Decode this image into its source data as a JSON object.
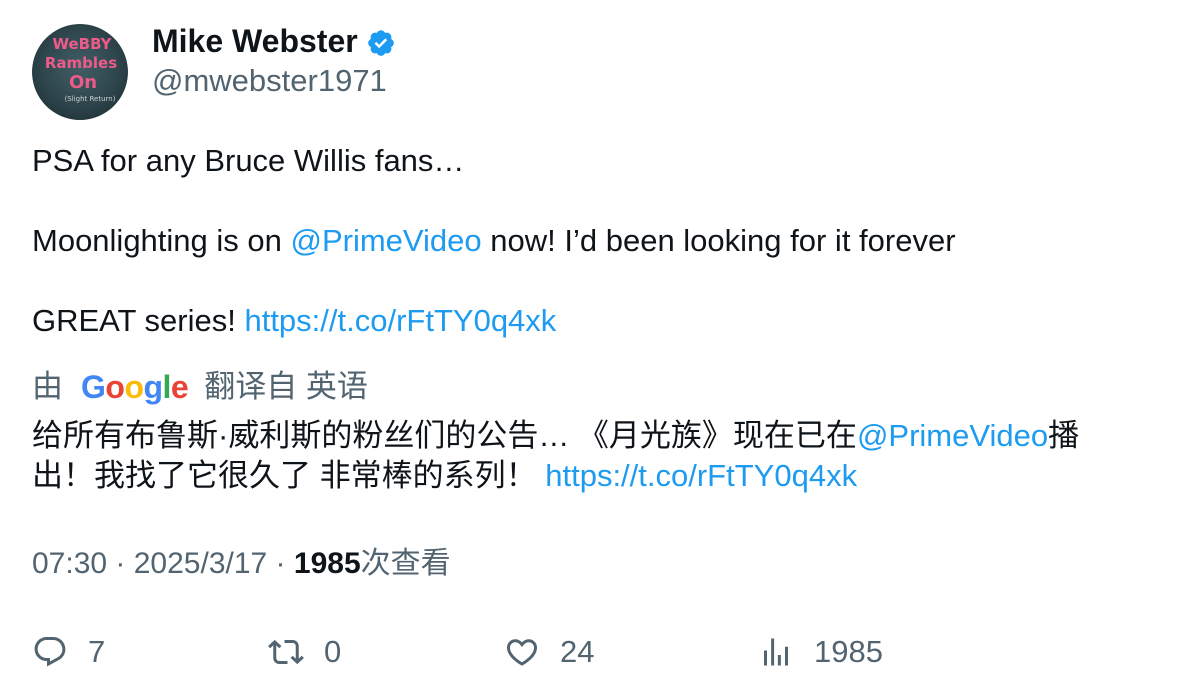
{
  "author": {
    "name": "Mike Webster",
    "handle": "@mwebster1971",
    "avatar_text": [
      "WeBBY",
      "Rambles",
      "On",
      "(Slight Return)"
    ]
  },
  "tweet": {
    "line1": "PSA for any Bruce Willis fans…",
    "line2_a": "Moonlighting is on ",
    "line2_mention": "@PrimeVideo",
    "line2_b": " now! I’d been looking for it forever",
    "line3_a": "GREAT series! ",
    "line3_link": "https://t.co/rFtTY0q4xk"
  },
  "translation": {
    "by": "由",
    "service": "Google",
    "label": "翻译自 英语",
    "line1_a": "给所有布鲁斯·威利斯的粉丝们的公告… 《月光族》现在已在",
    "line1_mention": "@PrimeVideo",
    "line1_b": "播",
    "line2_a": "出！我找了它很久了 非常棒的系列！ ",
    "line2_link": "https://t.co/rFtTY0q4xk"
  },
  "meta": {
    "time": "07:30",
    "sep1": " · ",
    "date": "2025/3/17",
    "sep2": " · ",
    "views_count": "1985",
    "views_label": "次查看"
  },
  "actions": {
    "replies": "7",
    "retweets": "0",
    "likes": "24",
    "views": "1985"
  },
  "colors": {
    "link": "#1d9bf0",
    "secondary_text": "#536471",
    "primary_text": "#0f1419",
    "avatar_bg": "#2f4a52",
    "avatar_text": "#ee5a8a"
  }
}
